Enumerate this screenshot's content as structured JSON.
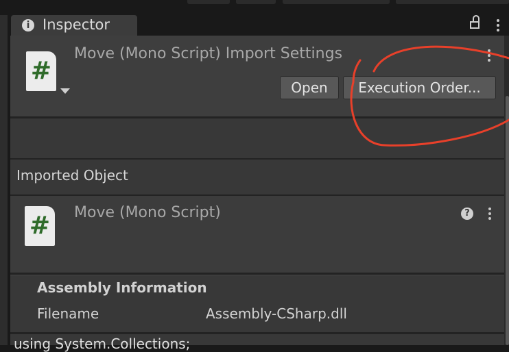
{
  "tab": {
    "label": "Inspector"
  },
  "header": {
    "title": "Move (Mono Script) Import Settings",
    "open_label": "Open",
    "execution_order_label": "Execution Order..."
  },
  "imported": {
    "section_label": "Imported Object",
    "title": "Move (Mono Script)"
  },
  "assembly": {
    "heading": "Assembly Information",
    "filename_label": "Filename",
    "filename_value": "Assembly-CSharp.dll"
  },
  "code_preview": "using System.Collections;",
  "icons": {
    "script": "#",
    "help": "?"
  },
  "annotation_color": "#e8402a"
}
